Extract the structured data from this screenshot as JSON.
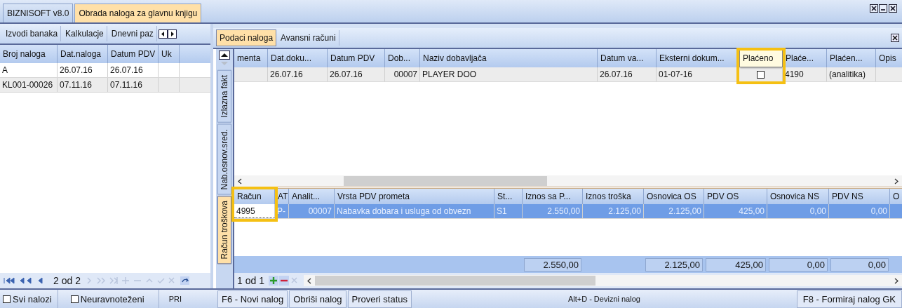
{
  "app_tabs": [
    {
      "label": "BIZNISOFT v8.0",
      "selected": false
    },
    {
      "label": "Obrada naloga za glavnu knjigu",
      "selected": true
    }
  ],
  "left_panel": {
    "tabs": [
      {
        "label": "Izvodi banaka",
        "selected": false
      },
      {
        "label": "Kalkulacje",
        "selected": false
      },
      {
        "label": "Dnevni paz",
        "selected": false
      }
    ],
    "columns": [
      "Broj naloga",
      "Dat.naloga",
      "Datum PDV",
      "Uk"
    ],
    "rows": [
      {
        "cells": [
          "A",
          "26.07.16",
          "26.07.16",
          null
        ],
        "selected": false
      },
      {
        "cells": [
          "KL001-00026",
          "07.11.16",
          "07.11.16",
          null
        ],
        "selected": true
      }
    ],
    "navigator": "2 od 2",
    "filters": [
      {
        "label": "Svi nalozi",
        "checked": false
      },
      {
        "label": "Neuravnoteženi",
        "checked": false
      }
    ],
    "status_text": "PRI"
  },
  "right_panel": {
    "tabs": [
      {
        "label": "Podaci naloga",
        "selected": true
      },
      {
        "label": "Avansni računi",
        "selected": false
      }
    ],
    "side_tabs": [
      {
        "label": "Izlazna fakt",
        "selected": false
      },
      {
        "label": "Nab.osnov.sred.",
        "selected": false
      },
      {
        "label": "Račun troškova",
        "selected": true
      }
    ],
    "upper_grid": {
      "columns": [
        {
          "label": "menta",
          "kind": "text",
          "highlighted": false
        },
        {
          "label": "Dat.doku...",
          "kind": "text",
          "highlighted": false
        },
        {
          "label": "Datum PDV",
          "kind": "text",
          "highlighted": false
        },
        {
          "label": "Dob...",
          "kind": "number",
          "highlighted": false
        },
        {
          "label": "Naziv dobavljača",
          "kind": "text",
          "highlighted": false
        },
        {
          "label": "Datum va...",
          "kind": "text",
          "highlighted": false
        },
        {
          "label": "Eksterni dokum...",
          "kind": "text",
          "highlighted": false
        },
        {
          "label": "Plaćeno",
          "kind": "checkbox",
          "highlighted": true
        },
        {
          "label": "Plaće...",
          "kind": "text",
          "highlighted": false
        },
        {
          "label": "Plaćen...",
          "kind": "text",
          "highlighted": false
        },
        {
          "label": "Opis",
          "kind": "text",
          "highlighted": false
        }
      ],
      "rows": [
        {
          "cells": [
            null,
            "26.07.16",
            "26.07.16",
            "00007",
            "PLAYER DOO",
            "26.07.16",
            "01-07-16",
            false,
            "4190",
            "(analitika)",
            null
          ],
          "selected": true
        }
      ]
    },
    "lower_grid": {
      "columns": [
        {
          "label": "Račun",
          "kind": "text",
          "highlighted": true
        },
        {
          "label": "AT",
          "kind": "text",
          "highlighted": false
        },
        {
          "label": "Analit...",
          "kind": "number",
          "highlighted": false
        },
        {
          "label": "Vrsta PDV prometa",
          "kind": "text",
          "highlighted": false
        },
        {
          "label": "St...",
          "kind": "text",
          "highlighted": false
        },
        {
          "label": "Iznos sa P...",
          "kind": "number",
          "highlighted": false,
          "total": "2.550,00"
        },
        {
          "label": "Iznos troška",
          "kind": "number",
          "highlighted": false
        },
        {
          "label": "Osnovica OS",
          "kind": "number",
          "highlighted": false,
          "total": "2.125,00"
        },
        {
          "label": "PDV OS",
          "kind": "number",
          "highlighted": false,
          "total": "425,00"
        },
        {
          "label": "Osnovica NS",
          "kind": "number",
          "highlighted": false,
          "total": "0,00"
        },
        {
          "label": "PDV NS",
          "kind": "number",
          "highlighted": false,
          "total": "0,00"
        },
        {
          "label": "O",
          "kind": "text",
          "highlighted": false
        }
      ],
      "rows": [
        {
          "cells": [
            "4995",
            "P-",
            "00007",
            "Nabavka dobara i usluga od obvezn",
            "S1",
            "2.550,00",
            "2.125,00",
            "2.125,00",
            "425,00",
            "0,00",
            "0,00",
            null
          ],
          "selected": true
        }
      ],
      "navigator": "1 od 1"
    },
    "buttons": [
      "F6 - Novi nalog",
      "Obriši nalog",
      "Proveri status"
    ],
    "center_hint": "Alt+D - Devizni nalog",
    "right_button": "F8 - Formiraj nalog GK"
  }
}
